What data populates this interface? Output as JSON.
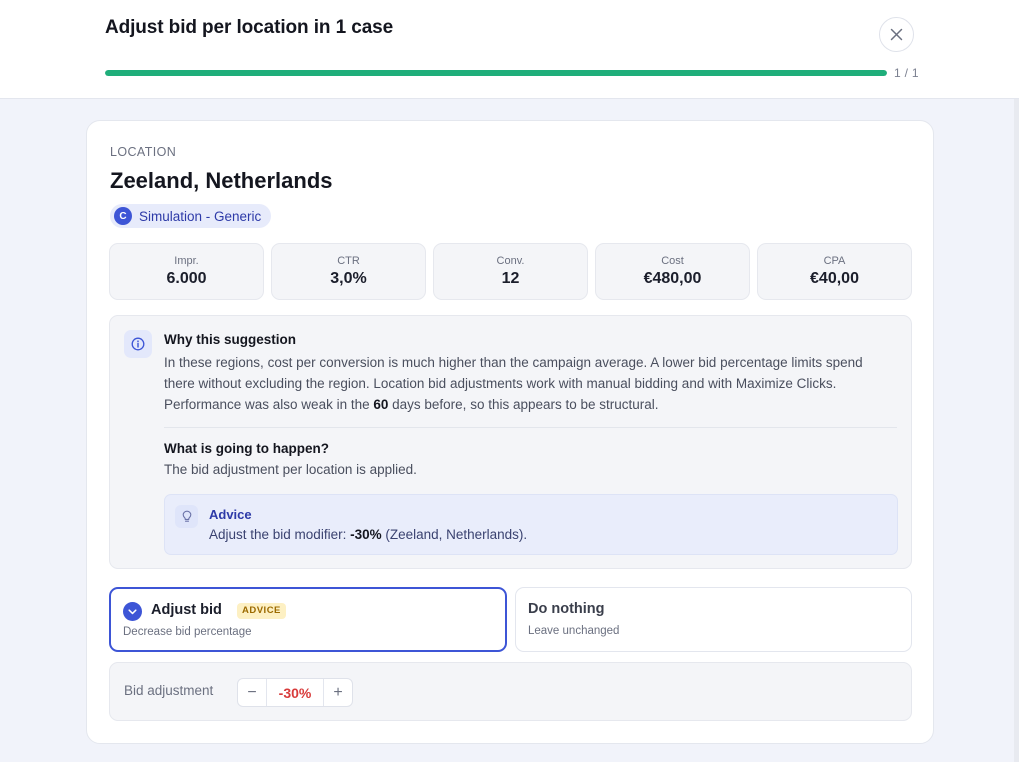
{
  "header": {
    "title": "Adjust bid per location in 1 case",
    "progress_count": "1 / 1",
    "progress_fraction": 1.0,
    "close_icon": "close-icon"
  },
  "location": {
    "eyebrow": "LOCATION",
    "name": "Zeeland, Netherlands",
    "campaign_avatar": "C",
    "campaign_name": "Simulation - Generic"
  },
  "metrics": [
    {
      "label": "Impr.",
      "value": "6.000"
    },
    {
      "label": "CTR",
      "value": "3,0%"
    },
    {
      "label": "Conv.",
      "value": "12"
    },
    {
      "label": "Cost",
      "value": "€480,00"
    },
    {
      "label": "CPA",
      "value": "€40,00"
    }
  ],
  "why": {
    "title": "Why this suggestion",
    "body_part1": "In these regions, cost per conversion is much higher than the campaign average. A lower bid percentage limits spend there without excluding the region. Location bid adjustments work with manual bidding and with Maximize Clicks. Performance was also weak in the ",
    "body_days": "60",
    "body_part2": " days before, so this appears to be structural.",
    "happen_title": "What is going to happen?",
    "happen_body": "The bid adjustment per location is applied."
  },
  "advice": {
    "title": "Advice",
    "text_prefix": "Adjust the bid modifier: ",
    "modifier": "-30%",
    "text_suffix": " (Zeeland, Netherlands)."
  },
  "options": {
    "adjust": {
      "title": "Adjust bid",
      "tag": "ADVICE",
      "subtitle": "Decrease bid percentage"
    },
    "nothing": {
      "title": "Do nothing",
      "subtitle": "Leave unchanged"
    }
  },
  "bid": {
    "label": "Bid adjustment",
    "minus": "−",
    "value": "-30%",
    "plus": "+"
  },
  "colors": {
    "accent": "#3d55d6",
    "progress": "#1fae7a",
    "negative": "#d83b3b",
    "advice_tag_bg": "#fdf0c3"
  }
}
